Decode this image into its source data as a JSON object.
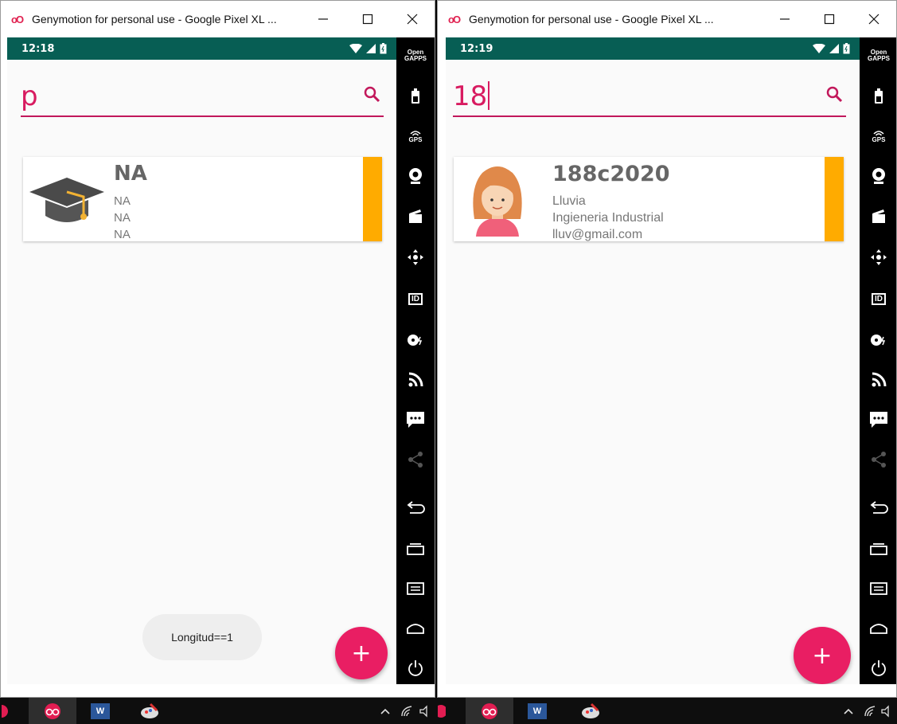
{
  "colors": {
    "accent": "#e91e63",
    "status_bar": "#075e54",
    "card_stripe": "#ffab00",
    "search_text": "#d81b60"
  },
  "left_window": {
    "title": "Genymotion for personal use - Google Pixel XL ...",
    "status": {
      "time": "12:18"
    },
    "search": {
      "value": "p"
    },
    "card": {
      "avatar_icon": "graduation-cap-icon",
      "title": "NA",
      "line1": "NA",
      "line2": "NA",
      "line3": "NA"
    },
    "toast": "Longitud==1",
    "fab": "+"
  },
  "right_window": {
    "title": "Genymotion for personal use - Google Pixel XL ...",
    "status": {
      "time": "12:19"
    },
    "search": {
      "value": "18"
    },
    "card": {
      "avatar_icon": "girl-avatar-icon",
      "title": "188c2020",
      "line1": "Lluvia",
      "line2": "Ingieneria Industrial",
      "line3": "lluv@gmail.com"
    },
    "fab": "+"
  },
  "toolbar": {
    "open_gapps": "Open\nGAPPS",
    "gps": "GPS",
    "id": "ID"
  },
  "window_controls": {
    "minimize": "—",
    "maximize": "☐",
    "close": "✕"
  },
  "taskbar": {
    "word": "W"
  }
}
